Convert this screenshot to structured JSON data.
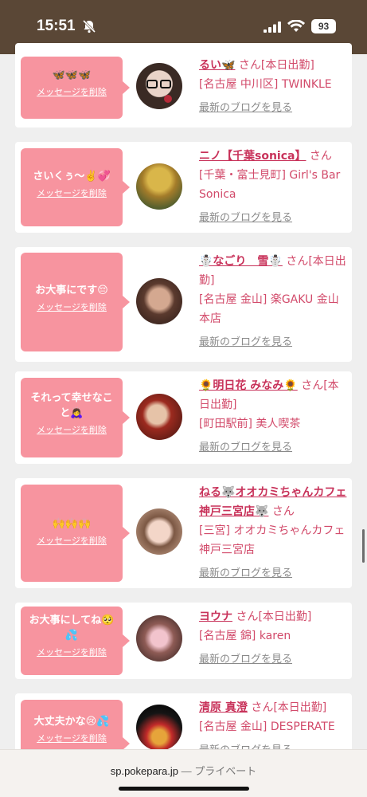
{
  "status_bar": {
    "time": "15:51",
    "battery": "93"
  },
  "messages": [
    {
      "msg": "🦋🦋🦋",
      "delete_label": "メッセージを削除",
      "name": "るい🦋",
      "honorific": "さん",
      "meta": "[本日出勤]",
      "shop": "[名古屋 中川区] TWINKLE",
      "blog": "最新のブログを見る"
    },
    {
      "msg": "さいくぅ〜✌️💞",
      "delete_label": "メッセージを削除",
      "name": "ニノ【千葉sonica】",
      "honorific": "さん",
      "meta": "",
      "shop": "[千葉・富士見町] Girl's Bar Sonica",
      "blog": "最新のブログを見る"
    },
    {
      "msg": "お大事にです😔",
      "delete_label": "メッセージを削除",
      "name": "☃️なごり　雪☃️",
      "honorific": "さん",
      "meta": "[本日出勤]",
      "shop": "[名古屋 金山] 楽GAKU 金山本店",
      "blog": "最新のブログを見る"
    },
    {
      "msg": "それって幸せなこと🙇‍♀️",
      "delete_label": "メッセージを削除",
      "name": "🌻明日花 みなみ🌻",
      "honorific": "さん",
      "meta": "[本日出勤]",
      "shop": "[町田駅前] 美人喫茶",
      "blog": "最新のブログを見る"
    },
    {
      "msg": "🙌🙌🙌",
      "delete_label": "メッセージを削除",
      "name": "ねる🐺オオカミちゃんカフェ神戸三宮店🐺",
      "honorific": "さん",
      "meta": "",
      "shop": "[三宮] オオカミちゃんカフェ神戸三宮店",
      "blog": "最新のブログを見る"
    },
    {
      "msg": "お大事にしてね🥺💦",
      "delete_label": "メッセージを削除",
      "name": "ヨウナ",
      "honorific": "さん",
      "meta": "[本日出勤]",
      "shop": "[名古屋 錦] karen",
      "blog": "最新のブログを見る"
    },
    {
      "msg": "大丈夫かな😢💦",
      "delete_label": "メッセージを削除",
      "name": "清原 真澄",
      "honorific": "さん",
      "meta": "[本日出勤]",
      "shop": "[名古屋 金山] DESPERATE",
      "blog": "最新のブログを見る"
    }
  ],
  "browser": {
    "domain": "sp.pokepara.jp",
    "mode": "— プライベート"
  }
}
